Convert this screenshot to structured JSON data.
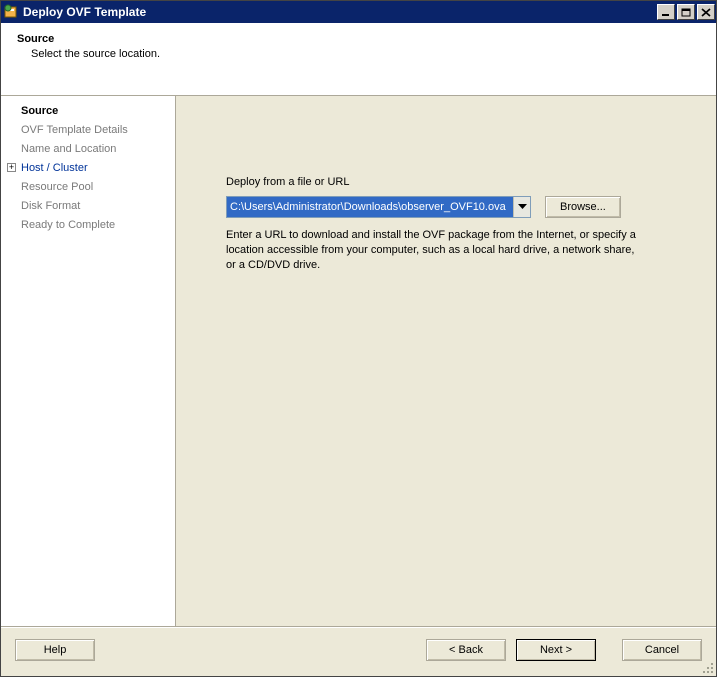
{
  "window": {
    "title": "Deploy OVF Template"
  },
  "header": {
    "title": "Source",
    "subtitle": "Select the source location."
  },
  "sidebar": {
    "steps": [
      {
        "label": "Source",
        "active": true
      },
      {
        "label": "OVF Template Details"
      },
      {
        "label": "Name and Location"
      },
      {
        "label": "Host / Cluster",
        "expander": "+"
      },
      {
        "label": "Resource Pool"
      },
      {
        "label": "Disk Format"
      },
      {
        "label": "Ready to Complete"
      }
    ]
  },
  "content": {
    "label": "Deploy from a file or URL",
    "path_value": "C:\\Users\\Administrator\\Downloads\\observer_OVF10.ova",
    "browse_label": "Browse...",
    "help_text": "Enter a URL to download and install the OVF package from the Internet, or specify a location accessible from your computer, such as a local hard drive, a network share, or a CD/DVD drive."
  },
  "footer": {
    "help": "Help",
    "back": "< Back",
    "next": "Next >",
    "cancel": "Cancel"
  }
}
